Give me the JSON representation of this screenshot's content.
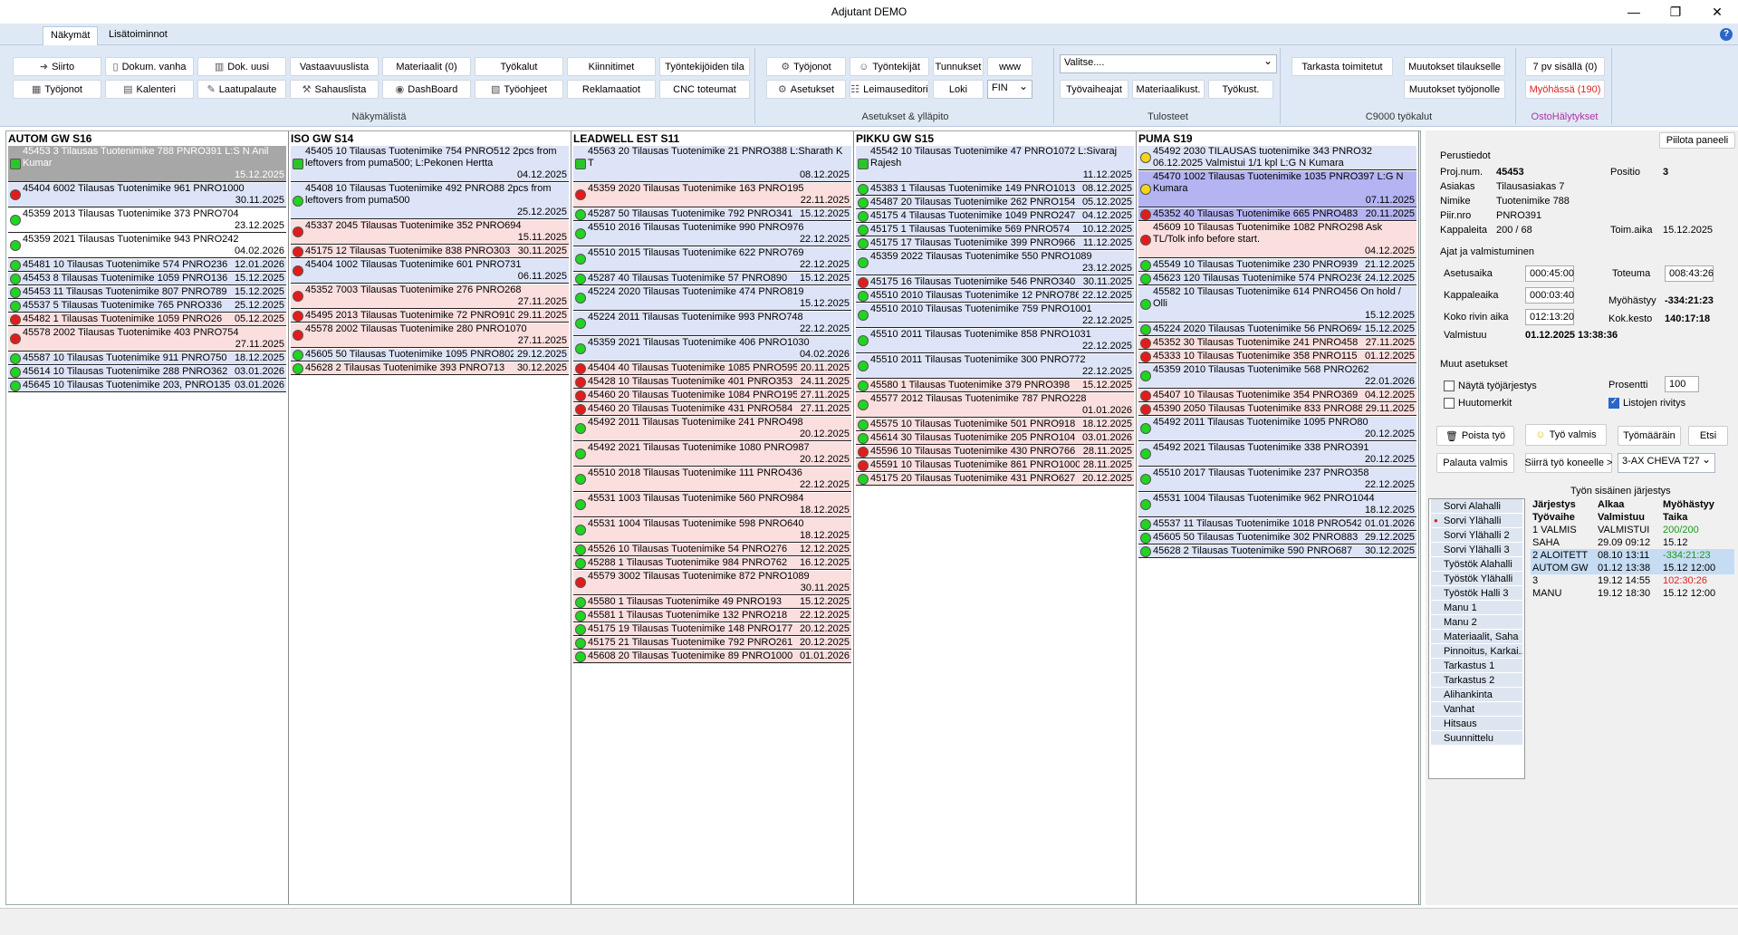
{
  "window": {
    "title": "Adjutant DEMO",
    "controls": [
      "—",
      "❐",
      "✕"
    ]
  },
  "tabs": [
    {
      "label": "Näkymät"
    },
    {
      "label": "Lisätoiminnot"
    }
  ],
  "help_icon": "?",
  "ribbon": {
    "groups": [
      "Näkymälistä",
      "Asetukset & ylläpito",
      "Tulosteet",
      "C9000 työkalut",
      "OstoHälytykset"
    ],
    "buttons": {
      "siirto": "Siirto",
      "tyojonot": "Työjonot",
      "dokum_vanha": "Dokum. vanha",
      "kalenteri": "Kalenteri",
      "dok_uusi": "Dok. uusi",
      "laatupalaute": "Laatupalaute",
      "vastaavuuslista": "Vastaavuuslista",
      "sahauslista": "Sahauslista",
      "materiaalit": "Materiaalit (0)",
      "dashboard": "DashBoard",
      "tyokalut": "Työkalut",
      "tyoohjeet": "Työohjeet",
      "kiinnitimet": "Kiinnitimet",
      "reklamaatiot": "Reklamaatiot",
      "tyontekijoiden_tila": "Työntekijöiden tila",
      "cnc_toteumat": "CNC toteumat",
      "tyojonot2": "Työjonot",
      "asetukset": "Asetukset",
      "tyontekijat": "Työntekijät",
      "leimauseditori": "Leimauseditori",
      "tunnukset": "Tunnukset",
      "loki": "Loki",
      "www": "www",
      "lang": "FIN",
      "valitse": "Valitse....",
      "tyovaiheajat": "Työvaiheajat",
      "materiaalikust": "Materiaalikust.",
      "tyokust": "Työkust.",
      "tarkasta_toimitetut": "Tarkasta toimitetut",
      "muutokset_tilaukselle": "Muutokset tilaukselle",
      "muutokset_tyojonolle": "Muutokset työjonolle",
      "pv7": "7 pv sisällä (0)",
      "myohassa": "Myöhässä (190)"
    }
  },
  "columns": [
    {
      "title": "AUTOM GW S16",
      "items": [
        {
          "text": "45453 3 Tilausas Tuotenimike 788 PNRO391 L:S N Anil Kumar",
          "date": "15.12.2025",
          "st": "ck",
          "bg": "gray",
          "two": true
        },
        {
          "text": "45404 6002 Tilausas Tuotenimike 961 PNRO1000",
          "date": "30.11.2025",
          "st": "r",
          "bg": "blue",
          "two": true
        },
        {
          "text": "45359 2013 Tilausas Tuotenimike 373 PNRO704",
          "date": "23.12.2025",
          "st": "g",
          "bg": "",
          "two": true
        },
        {
          "text": "45359 2021 Tilausas Tuotenimike 943 PNRO242",
          "date": "04.02.2026",
          "st": "g",
          "bg": "",
          "two": true
        },
        {
          "text": "45481 10 Tilausas Tuotenimike 574 PNRO236",
          "date": "12.01.2026",
          "st": "g",
          "bg": "blue"
        },
        {
          "text": "45453 8 Tilausas Tuotenimike 1059 PNRO136",
          "date": "15.12.2025",
          "st": "g",
          "bg": "blue"
        },
        {
          "text": "45453 11 Tilausas Tuotenimike 807 PNRO789",
          "date": "15.12.2025",
          "st": "g",
          "bg": "blue"
        },
        {
          "text": "45537 5 Tilausas Tuotenimike 765 PNRO336",
          "date": "25.12.2025",
          "st": "g",
          "bg": "blue"
        },
        {
          "text": "45482 1 Tilausas Tuotenimike 1059 PNRO26",
          "date": "05.12.2025",
          "st": "r",
          "bg": "pink"
        },
        {
          "text": "45578 2002 Tilausas Tuotenimike 403 PNRO754",
          "date": "27.11.2025",
          "st": "r",
          "bg": "pink",
          "two": true
        },
        {
          "text": "45587 10 Tilausas Tuotenimike 911 PNRO750",
          "date": "18.12.2025",
          "st": "g",
          "bg": "blue"
        },
        {
          "text": "45614 10 Tilausas Tuotenimike 288 PNRO362",
          "date": "03.01.2026",
          "st": "g",
          "bg": "blue"
        },
        {
          "text": "45645 10 Tilausas Tuotenimike 203, PNRO135",
          "date": "03.01.2026",
          "st": "g",
          "bg": "blue"
        }
      ]
    },
    {
      "title": "ISO GW S14",
      "items": [
        {
          "text": "45405 10 Tilausas Tuotenimike 754 PNRO512 2pcs from leftovers from puma500; L:Pekonen Hertta",
          "date": "04.12.2025",
          "st": "ck",
          "bg": "blue",
          "two": true
        },
        {
          "text": "45408 10 Tilausas Tuotenimike 492 PNRO88 2pcs from leftovers from puma500",
          "date": "25.12.2025",
          "st": "g",
          "bg": "blue",
          "two": true
        },
        {
          "text": "45337 2045 Tilausas Tuotenimike 352 PNRO694",
          "date": "15.11.2025",
          "st": "r",
          "bg": "pink",
          "two": true
        },
        {
          "text": "45175 12 Tilausas Tuotenimike 838 PNRO303",
          "date": "30.11.2025",
          "st": "r",
          "bg": "pink"
        },
        {
          "text": "45404 1002 Tilausas Tuotenimike 601 PNRO731",
          "date": "06.11.2025",
          "st": "r",
          "bg": "blue",
          "two": true
        },
        {
          "text": "45352 7003 Tilausas Tuotenimike 276 PNRO268",
          "date": "27.11.2025",
          "st": "r",
          "bg": "pink",
          "two": true
        },
        {
          "text": "45495 2013 Tilausas Tuotenimike 72 PNRO910",
          "date": "29.11.2025",
          "st": "r",
          "bg": "pink"
        },
        {
          "text": "45578 2002 Tilausas Tuotenimike 280 PNRO1070",
          "date": "27.11.2025",
          "st": "r",
          "bg": "pink",
          "two": true
        },
        {
          "text": "45605 50 Tilausas Tuotenimike 1095 PNRO802",
          "date": "29.12.2025",
          "st": "g",
          "bg": "blue"
        },
        {
          "text": "45628 2 Tilausas Tuotenimike 393 PNRO713",
          "date": "30.12.2025",
          "st": "g",
          "bg": "pink"
        }
      ]
    },
    {
      "title": "LEADWELL EST S11",
      "items": [
        {
          "text": "45563 20 Tilausas Tuotenimike 21 PNRO388 L:Sharath K T",
          "date": "08.12.2025",
          "st": "ck",
          "bg": "blue",
          "two": true
        },
        {
          "text": "45359 2020 Tilausas Tuotenimike 163 PNRO195",
          "date": "22.11.2025",
          "st": "r",
          "bg": "pink",
          "two": true
        },
        {
          "text": "45287 50 Tilausas Tuotenimike 792 PNRO341",
          "date": "15.12.2025",
          "st": "g",
          "bg": "blue"
        },
        {
          "text": "45510 2016 Tilausas Tuotenimike 990 PNRO976",
          "date": "22.12.2025",
          "st": "g",
          "bg": "blue",
          "two": true
        },
        {
          "text": "45510 2015 Tilausas Tuotenimike 622 PNRO769",
          "date": "22.12.2025",
          "st": "g",
          "bg": "blue",
          "two": true
        },
        {
          "text": "45287 40 Tilausas Tuotenimike 57 PNRO890",
          "date": "15.12.2025",
          "st": "g",
          "bg": "blue"
        },
        {
          "text": "45224 2020 Tilausas Tuotenimike 474 PNRO819",
          "date": "15.12.2025",
          "st": "g",
          "bg": "blue",
          "two": true
        },
        {
          "text": "45224 2011 Tilausas Tuotenimike 993 PNRO748",
          "date": "22.12.2025",
          "st": "g",
          "bg": "blue",
          "two": true
        },
        {
          "text": "45359 2021 Tilausas Tuotenimike 406 PNRO1030",
          "date": "04.02.2026",
          "st": "g",
          "bg": "blue",
          "two": true
        },
        {
          "text": "45404 40 Tilausas Tuotenimike 1085 PNRO595",
          "date": "20.11.2025",
          "st": "r",
          "bg": "pink"
        },
        {
          "text": "45428 10 Tilausas Tuotenimike 401 PNRO353",
          "date": "24.11.2025",
          "st": "r",
          "bg": "pink"
        },
        {
          "text": "45460 20 Tilausas Tuotenimike 1084 PNRO195",
          "date": "27.11.2025",
          "st": "r",
          "bg": "pink"
        },
        {
          "text": "45460 20 Tilausas Tuotenimike 431 PNRO584",
          "date": "27.11.2025",
          "st": "r",
          "bg": "pink"
        },
        {
          "text": "45492 2011 Tilausas Tuotenimike 241 PNRO498",
          "date": "20.12.2025",
          "st": "g",
          "bg": "pink",
          "two": true
        },
        {
          "text": "45492 2021 Tilausas Tuotenimike 1080 PNRO987",
          "date": "20.12.2025",
          "st": "g",
          "bg": "pink",
          "two": true
        },
        {
          "text": "45510 2018 Tilausas Tuotenimike 111 PNRO436",
          "date": "22.12.2025",
          "st": "g",
          "bg": "pink",
          "two": true
        },
        {
          "text": "45531 1003 Tilausas Tuotenimike 560 PNRO984",
          "date": "18.12.2025",
          "st": "g",
          "bg": "pink",
          "two": true
        },
        {
          "text": "45531 1004 Tilausas Tuotenimike 598 PNRO640",
          "date": "18.12.2025",
          "st": "g",
          "bg": "pink",
          "two": true
        },
        {
          "text": "45526 10 Tilausas Tuotenimike 54 PNRO276",
          "date": "12.12.2025",
          "st": "g",
          "bg": "pink"
        },
        {
          "text": "45288 1 Tilausas Tuotenimike 984 PNRO762",
          "date": "16.12.2025",
          "st": "g",
          "bg": "pink"
        },
        {
          "text": "45579 3002 Tilausas Tuotenimike 872 PNRO1089",
          "date": "30.11.2025",
          "st": "r",
          "bg": "pink",
          "two": true
        },
        {
          "text": "45580 1 Tilausas Tuotenimike 49 PNRO193",
          "date": "15.12.2025",
          "st": "g",
          "bg": "pink"
        },
        {
          "text": "45581 1 Tilausas Tuotenimike 132 PNRO218",
          "date": "22.12.2025",
          "st": "g",
          "bg": "pink"
        },
        {
          "text": "45175 19 Tilausas Tuotenimike 148 PNRO177",
          "date": "20.12.2025",
          "st": "g",
          "bg": "pink"
        },
        {
          "text": "45175 21 Tilausas Tuotenimike 792 PNRO261",
          "date": "20.12.2025",
          "st": "g",
          "bg": "pink"
        },
        {
          "text": "45608 20 Tilausas Tuotenimike 89 PNRO1000",
          "date": "01.01.2026",
          "st": "g",
          "bg": "pink"
        }
      ]
    },
    {
      "title": "PIKKU GW S15",
      "items": [
        {
          "text": "45542 10 Tilausas Tuotenimike 47 PNRO1072 L:Sivaraj Rajesh",
          "date": "11.12.2025",
          "st": "ck",
          "bg": "blue",
          "two": true
        },
        {
          "text": "45383 1 Tilausas Tuotenimike 149 PNRO1013",
          "date": "08.12.2025",
          "st": "g",
          "bg": "blue"
        },
        {
          "text": "45487 20 Tilausas Tuotenimike 262 PNRO154",
          "date": "05.12.2025",
          "st": "g",
          "bg": "blue"
        },
        {
          "text": "45175 4 Tilausas Tuotenimike 1049 PNRO247",
          "date": "04.12.2025",
          "st": "g",
          "bg": "blue"
        },
        {
          "text": "45175 1 Tilausas Tuotenimike 569 PNRO574",
          "date": "10.12.2025",
          "st": "g",
          "bg": "blue"
        },
        {
          "text": "45175 17 Tilausas Tuotenimike 399 PNRO966",
          "date": "11.12.2025",
          "st": "g",
          "bg": "blue"
        },
        {
          "text": "45359 2022 Tilausas Tuotenimike 550 PNRO1089",
          "date": "23.12.2025",
          "st": "g",
          "bg": "blue",
          "two": true
        },
        {
          "text": "45175 16 Tilausas Tuotenimike 546 PNRO340",
          "date": "30.11.2025",
          "st": "r",
          "bg": "blue"
        },
        {
          "text": "45510 2010 Tilausas Tuotenimike 12 PNRO786",
          "date": "22.12.2025",
          "st": "g",
          "bg": "blue"
        },
        {
          "text": "45510 2010 Tilausas Tuotenimike 759 PNRO1001",
          "date": "22.12.2025",
          "st": "g",
          "bg": "blue",
          "two": true
        },
        {
          "text": "45510 2011 Tilausas Tuotenimike 858 PNRO1031",
          "date": "22.12.2025",
          "st": "g",
          "bg": "blue",
          "two": true
        },
        {
          "text": "45510 2011 Tilausas Tuotenimike 300 PNRO772",
          "date": "22.12.2025",
          "st": "g",
          "bg": "blue",
          "two": true
        },
        {
          "text": "45580 1 Tilausas Tuotenimike 379 PNRO398",
          "date": "15.12.2025",
          "st": "g",
          "bg": "pink"
        },
        {
          "text": "45577 2012 Tilausas Tuotenimike 787 PNRO228",
          "date": "01.01.2026",
          "st": "g",
          "bg": "pink",
          "two": true
        },
        {
          "text": "45575 10 Tilausas Tuotenimike 501 PNRO918",
          "date": "18.12.2025",
          "st": "g",
          "bg": "pink"
        },
        {
          "text": "45614 30 Tilausas Tuotenimike 205 PNRO104",
          "date": "03.01.2026",
          "st": "g",
          "bg": "pink"
        },
        {
          "text": "45596 10 Tilausas Tuotenimike 430 PNRO766",
          "date": "28.11.2025",
          "st": "r",
          "bg": "pink"
        },
        {
          "text": "45591 10 Tilausas Tuotenimike 861 PNRO1000",
          "date": "28.11.2025",
          "st": "r",
          "bg": "pink"
        },
        {
          "text": "45175 20 Tilausas Tuotenimike 431 PNRO627",
          "date": "20.12.2025",
          "st": "g",
          "bg": "pink"
        }
      ]
    },
    {
      "title": "PUMA S19",
      "items": [
        {
          "text": "45492 2030 TILAUSAS tuotenimike 343 PNRO32 06.12.2025 Valmistui 1/1 kpl L:G N Kumara",
          "date": "",
          "st": "y",
          "bg": "blue",
          "two": true
        },
        {
          "text": "45470 1002 Tilausas Tuotenimike 1035 PNRO397 L:G N Kumara",
          "date": "07.11.2025",
          "st": "y",
          "bg": "purple",
          "two": true
        },
        {
          "text": "45352 40 Tilausas Tuotenimike 665 PNRO483",
          "date": "20.11.2025",
          "st": "r",
          "bg": "purple"
        },
        {
          "text": "45609 10 Tilausas Tuotenimike 1082 PNRO298 Ask TL/Tolk info before start.",
          "date": "04.12.2025",
          "st": "r",
          "bg": "pink",
          "two": true
        },
        {
          "text": "45549 10 Tilausas Tuotenimike 230 PNRO939",
          "date": "21.12.2025",
          "st": "g",
          "bg": "blue"
        },
        {
          "text": "45623 120 Tilausas Tuotenimike 574 PNRO236",
          "date": "24.12.2025",
          "st": "g",
          "bg": "blue"
        },
        {
          "text": "45582 10 Tilausas Tuotenimike 614 PNRO456 On hold / Olli",
          "date": "15.12.2025",
          "st": "g",
          "bg": "blue",
          "two": true
        },
        {
          "text": "45224 2020 Tilausas Tuotenimike 56 PNRO694",
          "date": "15.12.2025",
          "st": "g",
          "bg": "blue"
        },
        {
          "text": "45352 30 Tilausas Tuotenimike 241 PNRO458",
          "date": "27.11.2025",
          "st": "r",
          "bg": "pink"
        },
        {
          "text": "45333 10 Tilausas Tuotenimike 358 PNRO115",
          "date": "01.12.2025",
          "st": "r",
          "bg": "pink"
        },
        {
          "text": "45359 2010 Tilausas Tuotenimike 568 PNRO262",
          "date": "22.01.2026",
          "st": "g",
          "bg": "blue",
          "two": true
        },
        {
          "text": "45407 10 Tilausas Tuotenimike 354 PNRO369",
          "date": "04.12.2025",
          "st": "r",
          "bg": "pink"
        },
        {
          "text": "45390 2050 Tilausas Tuotenimike 833 PNRO88",
          "date": "29.11.2025",
          "st": "r",
          "bg": "pink"
        },
        {
          "text": "45492 2011 Tilausas Tuotenimike 1095 PNRO80",
          "date": "20.12.2025",
          "st": "g",
          "bg": "blue",
          "two": true
        },
        {
          "text": "45492 2021 Tilausas Tuotenimike 338 PNRO391",
          "date": "20.12.2025",
          "st": "g",
          "bg": "blue",
          "two": true
        },
        {
          "text": "45510 2017 Tilausas Tuotenimike 237 PNRO358",
          "date": "22.12.2025",
          "st": "g",
          "bg": "blue",
          "two": true
        },
        {
          "text": "45531 1004 Tilausas Tuotenimike 962 PNRO1044",
          "date": "18.12.2025",
          "st": "g",
          "bg": "blue",
          "two": true
        },
        {
          "text": "45537 11 Tilausas Tuotenimike 1018 PNRO542",
          "date": "01.01.2026",
          "st": "g",
          "bg": "blue"
        },
        {
          "text": "45605 50 Tilausas Tuotenimike 302 PNRO883",
          "date": "29.12.2025",
          "st": "g",
          "bg": "blue"
        },
        {
          "text": "45628 2 Tilausas Tuotenimike 590 PNRO687",
          "date": "30.12.2025",
          "st": "g",
          "bg": "blue"
        }
      ]
    }
  ],
  "panel": {
    "hide_button": "Piilota paneeli",
    "section_basic": "Perustiedot",
    "proj_label": "Proj.num.",
    "proj_value": "45453",
    "positio_label": "Positio",
    "positio_value": "3",
    "asiakas_label": "Asiakas",
    "asiakas_value": "Tilausasiakas 7",
    "nimike_label": "Nimike",
    "nimike_value": "Tuotenimike 788",
    "piir_label": "Piir.nro",
    "piir_value": "PNRO391",
    "kpl_label": "Kappaleita",
    "kpl_value": "200 / 68",
    "toim_label": "Toim.aika",
    "toim_value": "15.12.2025",
    "section_times": "Ajat ja valmistuminen",
    "asetusaika_label": "Asetusaika",
    "asetusaika_value": "000:45:00",
    "toteuma_label": "Toteuma",
    "toteuma_value": "008:43:26",
    "kpl_aika_label": "Kappaleaika",
    "kpl_aika_value": "000:03:40",
    "myohastyy_label": "Myöhästyy",
    "myohastyy_value": "-334:21:23",
    "koko_label": "Koko rivin aika",
    "koko_value": "012:13:20",
    "kokkesto_label": "Kok.kesto",
    "kokkesto_value": "140:17:18",
    "valmistuu_label": "Valmistuu",
    "valmistuu_value": "01.12.2025 13:38:36",
    "section_other": "Muut asetukset",
    "nayta_label": "Näytä työjärjestys",
    "huomerkit_label": "Huutomerkit",
    "prosentti_label": "Prosentti",
    "prosentti_value": "100",
    "listojen_label": "Listojen rivitys",
    "poista": "Poista työ",
    "valmis": "Työ valmis",
    "tyomaarain": "Työmääräin",
    "etsi": "Etsi",
    "palauta": "Palauta valmis",
    "siirra": "Siirrä työ koneelle >",
    "kone": "3-AX CHEVA T27",
    "order_title": "Työn sisäinen järjestys",
    "machines": [
      "Sorvi Alahalli",
      "Sorvi Ylähalli",
      "Sorvi Ylähalli 2",
      "Sorvi Ylähalli 3",
      "Työstök Alahalli",
      "Työstök Ylähalli",
      "Työstök Halli 3",
      "Manu 1",
      "Manu 2",
      "Materiaalit, Saha",
      "Pinnoitus, Karkai...",
      "Tarkastus 1",
      "Tarkastus 2",
      "Alihankinta",
      "Vanhat",
      "Hitsaus",
      "Suunnittelu"
    ],
    "order_head": [
      [
        "Järjestys",
        "Alkaa",
        "Myöhästyy"
      ],
      [
        "Työvaihe",
        "Valmistuu",
        "Taika"
      ]
    ],
    "order_rows": [
      [
        "1 VALMIS",
        "VALMISTUI",
        "200/200"
      ],
      [
        "SAHA",
        "29.09 09:12",
        "15.12"
      ],
      [
        "2 ALOITETT",
        "08.10 13:11",
        "-334:21:23"
      ],
      [
        "AUTOM GW",
        "01.12 13:38",
        "15.12 12:00"
      ],
      [
        "3",
        "19.12 14:55",
        "102:30:26"
      ],
      [
        "MANU",
        "19.12 18:30",
        "15.12 12:00"
      ]
    ]
  }
}
